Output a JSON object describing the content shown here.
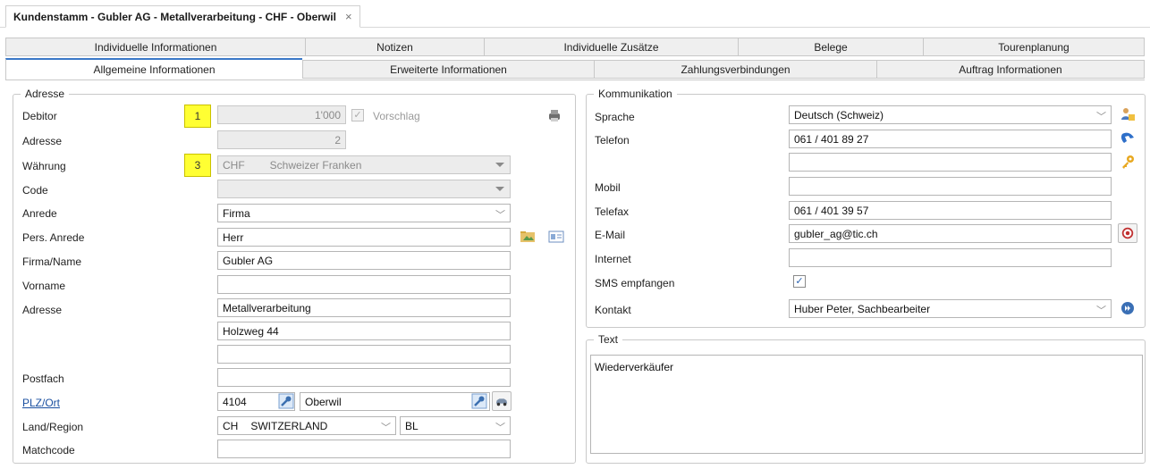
{
  "document_tab": {
    "title": "Kundenstamm - Gubler AG - Metallverarbeitung - CHF - Oberwil",
    "close": "×"
  },
  "tabs_row1": [
    "Individuelle Informationen",
    "Notizen",
    "Individuelle Zusätze",
    "Belege",
    "Tourenplanung"
  ],
  "tabs_row2": [
    "Allgemeine Informationen",
    "Erweiterte Informationen",
    "Zahlungsverbindungen",
    "Auftrag Informationen"
  ],
  "active_tab": "Allgemeine Informationen",
  "adresse": {
    "group_title": "Adresse",
    "labels": {
      "debitor": "Debitor",
      "adresse_nr": "Adresse",
      "waehrung": "Währung",
      "code": "Code",
      "anrede": "Anrede",
      "pers_anrede": "Pers. Anrede",
      "firma_name": "Firma/Name",
      "vorname": "Vorname",
      "adresse": "Adresse",
      "postfach": "Postfach",
      "plz_ort": "PLZ/Ort",
      "land_region": "Land/Region",
      "matchcode": "Matchcode"
    },
    "markers": {
      "debitor": "1",
      "waehrung": "3"
    },
    "values": {
      "debitor": "1'000",
      "vorschlag_label": "Vorschlag",
      "vorschlag_checked": true,
      "adresse_nr": "2",
      "waehrung_code": "CHF",
      "waehrung_name": "Schweizer Franken",
      "code": "",
      "anrede": "Firma",
      "pers_anrede": "Herr",
      "firma_name": "Gubler AG",
      "vorname": "",
      "adresse_line1": "Metallverarbeitung",
      "adresse_line2": "Holzweg 44",
      "adresse_line3": "",
      "postfach": "",
      "plz": "4104",
      "ort": "Oberwil",
      "land_code": "CH",
      "land_name": "SWITZERLAND",
      "region": "BL",
      "matchcode": ""
    }
  },
  "kommunikation": {
    "group_title": "Kommunikation",
    "labels": {
      "sprache": "Sprache",
      "telefon": "Telefon",
      "mobil": "Mobil",
      "telefax": "Telefax",
      "email": "E-Mail",
      "internet": "Internet",
      "sms": "SMS empfangen",
      "kontakt": "Kontakt"
    },
    "values": {
      "sprache": "Deutsch (Schweiz)",
      "telefon": "061 / 401 89 27",
      "telefon2": "",
      "mobil": "",
      "telefax": "061 / 401 39 57",
      "email": "gubler_ag@tic.ch",
      "internet": "",
      "sms_checked": true,
      "kontakt": "Huber Peter, Sachbearbeiter"
    }
  },
  "text_group": {
    "group_title": "Text",
    "content": "Wiederverkäufer"
  },
  "colors": {
    "accent": "#3a78c8",
    "marker": "#ffff33",
    "border": "#b5b5b5",
    "disabled": "#ececec"
  }
}
